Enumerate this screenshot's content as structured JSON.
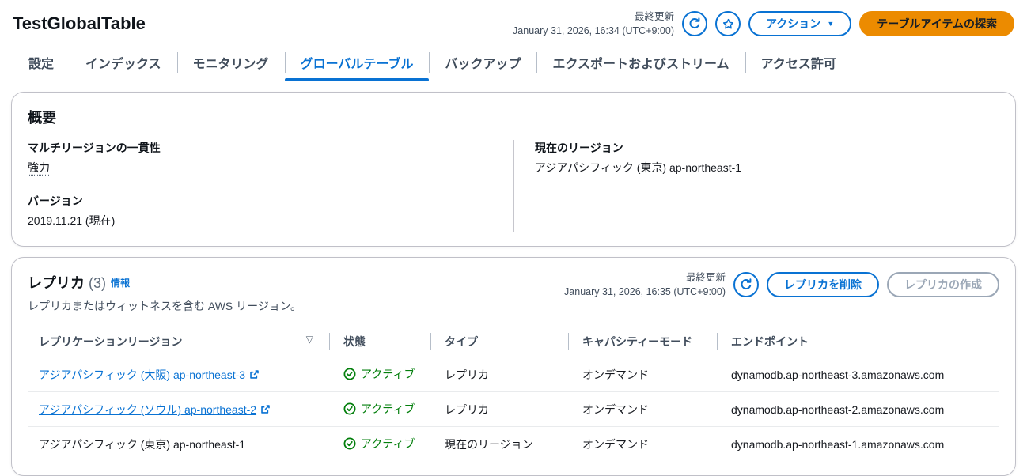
{
  "colors": {
    "accent_blue": "#0972d3",
    "primary_orange": "#ec8b00",
    "status_green": "#037f0c",
    "text_primary": "#16191f",
    "text_secondary": "#414d5c"
  },
  "header": {
    "title": "TestGlobalTable",
    "last_updated_label": "最終更新",
    "last_updated_value": "January 31, 2026, 16:34 (UTC+9:00)",
    "actions_button_label": "アクション",
    "explore_button_label": "テーブルアイテムの探索"
  },
  "tabs": [
    {
      "label": "設定"
    },
    {
      "label": "インデックス"
    },
    {
      "label": "モニタリング"
    },
    {
      "label": "グローバルテーブル"
    },
    {
      "label": "バックアップ"
    },
    {
      "label": "エクスポートおよびストリーム"
    },
    {
      "label": "アクセス許可"
    }
  ],
  "overview": {
    "title": "概要",
    "consistency_label": "マルチリージョンの一貫性",
    "consistency_value": "強力",
    "version_label": "バージョン",
    "version_value": "2019.11.21 (現在)",
    "current_region_label": "現在のリージョン",
    "current_region_value": "アジアパシフィック (東京) ap-northeast-1"
  },
  "replicas": {
    "title": "レプリカ",
    "count": "(3)",
    "info_link_label": "情報",
    "description": "レプリカまたはウィットネスを含む AWS リージョン。",
    "last_updated_label": "最終更新",
    "last_updated_value": "January 31, 2026, 16:35 (UTC+9:00)",
    "delete_button_label": "レプリカを削除",
    "create_button_label": "レプリカの作成",
    "table": {
      "columns": [
        "レプリケーションリージョン",
        "状態",
        "タイプ",
        "キャパシティーモード",
        "エンドポイント"
      ],
      "rows": [
        {
          "region": "アジアパシフィック (大阪) ap-northeast-3",
          "status": "アクティブ",
          "type": "レプリカ",
          "capacity_mode": "オンデマンド",
          "endpoint": "dynamodb.ap-northeast-3.amazonaws.com"
        },
        {
          "region": "アジアパシフィック (ソウル) ap-northeast-2",
          "status": "アクティブ",
          "type": "レプリカ",
          "capacity_mode": "オンデマンド",
          "endpoint": "dynamodb.ap-northeast-2.amazonaws.com"
        },
        {
          "region": "アジアパシフィック (東京) ap-northeast-1",
          "status": "アクティブ",
          "type": "現在のリージョン",
          "capacity_mode": "オンデマンド",
          "endpoint": "dynamodb.ap-northeast-1.amazonaws.com"
        }
      ]
    }
  }
}
